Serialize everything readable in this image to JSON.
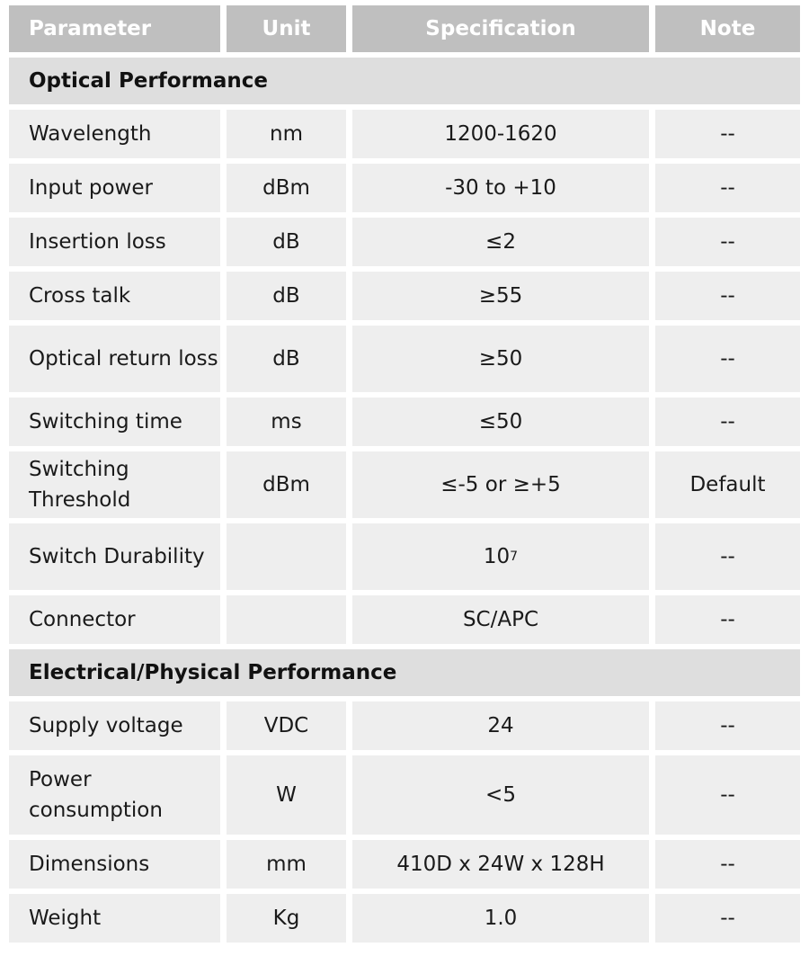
{
  "table": {
    "headers": [
      "Parameter",
      "Unit",
      "Specification",
      "Note"
    ],
    "sections": [
      {
        "title": "Optical Performance",
        "rows": [
          {
            "parameter": "Wavelength",
            "unit": "nm",
            "spec": "1200-1620",
            "note": "--"
          },
          {
            "parameter": "Input power",
            "unit": "dBm",
            "spec": "-30 to +10",
            "note": "--"
          },
          {
            "parameter": "Insertion loss",
            "unit": "dB",
            "spec": "≤2",
            "note": "--"
          },
          {
            "parameter": "Cross talk",
            "unit": "dB",
            "spec": "≥55",
            "note": "--"
          },
          {
            "parameter": "Optical return loss",
            "unit": "dB",
            "spec": "≥50",
            "note": "--"
          },
          {
            "parameter": "Switching time",
            "unit": "ms",
            "spec": "≤50",
            "note": "--"
          },
          {
            "parameter": "Switching Threshold",
            "unit": "dBm",
            "spec": "≤-5 or ≥+5",
            "note": "Default"
          },
          {
            "parameter": "Switch Durability",
            "unit": "",
            "spec_base": "10",
            "spec_exp": "7",
            "note": "--"
          },
          {
            "parameter": "Connector",
            "unit": "",
            "spec": "SC/APC",
            "note": "--"
          }
        ]
      },
      {
        "title": "Electrical/Physical Performance",
        "rows": [
          {
            "parameter": "Supply voltage",
            "unit": "VDC",
            "spec": "24",
            "note": "--"
          },
          {
            "parameter": "Power consumption",
            "unit": "W",
            "spec": "<5",
            "note": "--"
          },
          {
            "parameter": "Dimensions",
            "unit": "mm",
            "spec": "410D x 24W x 128H",
            "note": "--"
          },
          {
            "parameter": "Weight",
            "unit": "Kg",
            "spec": "1.0",
            "note": "--"
          }
        ]
      }
    ]
  }
}
